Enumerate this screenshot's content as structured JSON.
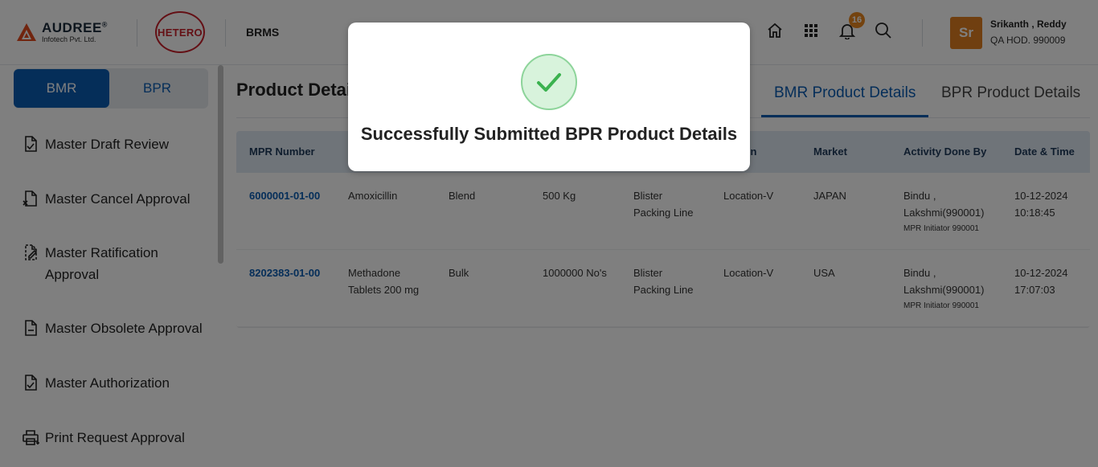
{
  "header": {
    "brand_name": "AUDREE",
    "brand_reg": "®",
    "brand_sub": "Infotech Pvt. Ltd.",
    "client_logo": "HETERO",
    "app_name": "BRMS",
    "notification_count": "16",
    "user": {
      "initials": "Sr",
      "name": "Srikanth , Reddy",
      "role": "QA HOD. 990009"
    },
    "colors": {
      "accent": "#0a5cb3",
      "badge": "#e8861e",
      "avatar": "#e07f20",
      "hetero": "#c8202b"
    }
  },
  "sidebar": {
    "toggle": {
      "active": "BMR",
      "inactive": "BPR"
    },
    "items": [
      {
        "label": "Master Draft Review",
        "icon": "document-check-icon"
      },
      {
        "label": "Master Cancel Approval",
        "icon": "document-cancel-icon"
      },
      {
        "label": "Master Ratification Approval",
        "line1": "Master Ratification",
        "line2": "Approval",
        "icon": "document-edit-icon"
      },
      {
        "label": "Master Obsolete Approval",
        "icon": "document-minus-icon"
      },
      {
        "label": "Master Authorization",
        "icon": "document-check-icon"
      },
      {
        "label": "Print Request Approval",
        "icon": "printer-icon"
      }
    ]
  },
  "main": {
    "title": "Product Detai",
    "tabs": {
      "active": "BMR Product Details",
      "inactive": "BPR Product Details"
    },
    "columns": {
      "mpr": "MPR Number",
      "location": "ion",
      "market": "Market",
      "activity": "Activity Done By",
      "datetime": "Date & Time"
    },
    "rows": [
      {
        "mpr": "6000001-01-00",
        "product": "Amoxicillin",
        "stage": "Blend",
        "batch": "500 Kg",
        "line1": "Blister",
        "line2": "Packing Line",
        "location": "Location-V",
        "market": "JAPAN",
        "by1": "Bindu ,",
        "by2": "Lakshmi(990001)",
        "by_role": "MPR Initiator 990001",
        "date": "10-12-2024",
        "time": "10:18:45"
      },
      {
        "mpr": "8202383-01-00",
        "product1": "Methadone",
        "product2": "Tablets 200 mg",
        "stage": "Bulk",
        "batch": "1000000 No's",
        "line1": "Blister",
        "line2": "Packing Line",
        "location": "Location-V",
        "market": "USA",
        "by1": "Bindu ,",
        "by2": "Lakshmi(990001)",
        "by_role": "MPR Initiator 990001",
        "date": "10-12-2024",
        "time": "17:07:03"
      }
    ]
  },
  "modal": {
    "message": "Successfully Submitted BPR Product Details",
    "icon": "check-circle-icon"
  }
}
